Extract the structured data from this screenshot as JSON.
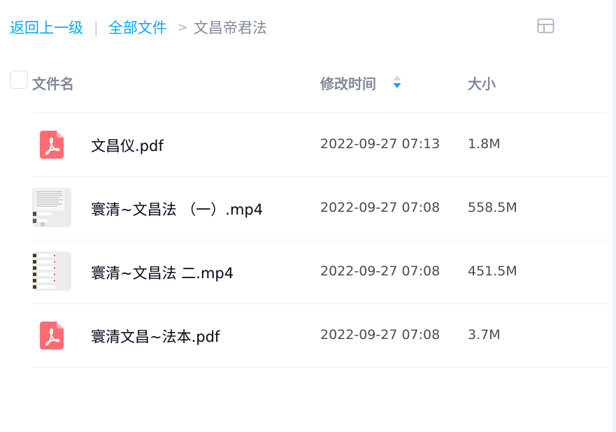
{
  "breadcrumb": {
    "back_label": "返回上一级",
    "divider": "|",
    "root_label": "全部文件",
    "arrow": ">",
    "current_label": "文昌帝君法"
  },
  "header": {
    "name_label": "文件名",
    "time_label": "修改时间",
    "size_label": "大小"
  },
  "files": [
    {
      "name": "文昌仪.pdf",
      "time": "2022-09-27 07:13",
      "size": "1.8M",
      "icon": "pdf-icon"
    },
    {
      "name": "寰清~文昌法 （一）.mp4",
      "time": "2022-09-27 07:08",
      "size": "558.5M",
      "icon": "video-thumbnail"
    },
    {
      "name": "寰清~文昌法 二.mp4",
      "time": "2022-09-27 07:08",
      "size": "451.5M",
      "icon": "video-thumbnail"
    },
    {
      "name": "寰清文昌~法本.pdf",
      "time": "2022-09-27 07:08",
      "size": "3.7M",
      "icon": "pdf-icon"
    }
  ],
  "colors": {
    "link": "#06a7ff",
    "pdf_red": "#ff6b73",
    "sort_active": "#06a7ff"
  }
}
